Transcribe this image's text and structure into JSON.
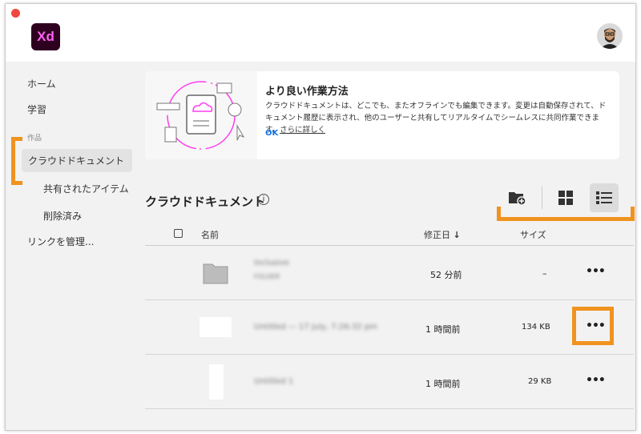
{
  "app": {
    "logo": "Xd"
  },
  "sidebar": {
    "home": "ホーム",
    "learn": "学習",
    "section": "作品",
    "cloud_docs": "クラウドドキュメント",
    "shared": "共有されたアイテム",
    "deleted": "削除済み",
    "manage_links": "リンクを管理..."
  },
  "banner": {
    "title": "より良い作業方法",
    "text": "クラウドドキュメントは、どこでも、またオフラインでも編集できます。変更は自動保存されて、ドキュメント履歴に表示され、他のユーザーと共有してリアルタイムでシームレスに共同作業できます。",
    "learn_more": "さらに詳しく",
    "ok": "OK"
  },
  "main": {
    "title": "クラウドドキュメント",
    "info": "i"
  },
  "table": {
    "headers": {
      "name": "名前",
      "modified": "修正日",
      "sort": "↓",
      "size": "サイズ"
    },
    "rows": [
      {
        "name": "Inclusive",
        "sub": "FOLDER",
        "modified": "52 分前",
        "size": "–",
        "more": "•••"
      },
      {
        "name": "Untitled — 17 July, 7:26:32 pm",
        "sub": "",
        "modified": "1 時間前",
        "size": "134 KB",
        "more": "•••"
      },
      {
        "name": "Untitled 1",
        "sub": "",
        "modified": "1 時間前",
        "size": "29 KB",
        "more": "•••"
      }
    ]
  },
  "colors": {
    "accent": "#1473e6",
    "highlight": "#f0931f",
    "brand": "#ff61f6"
  }
}
